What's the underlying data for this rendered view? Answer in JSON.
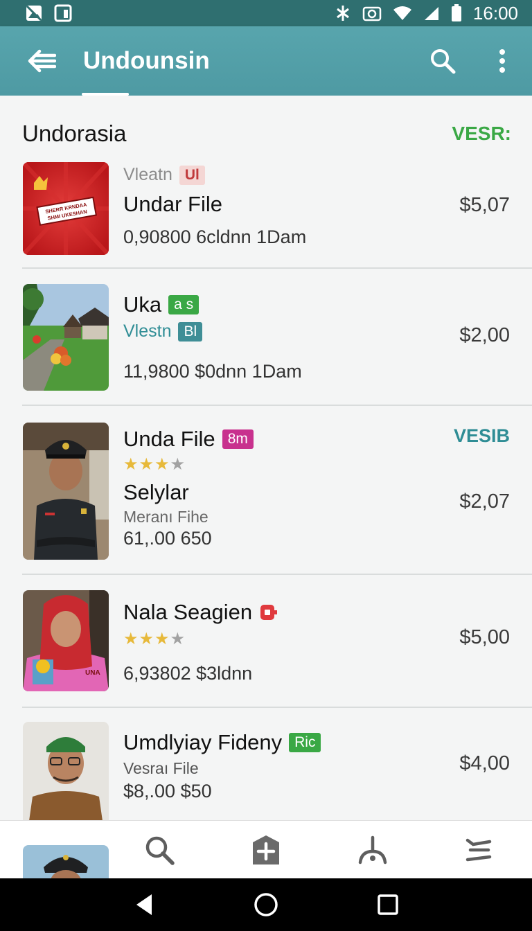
{
  "status_bar": {
    "time": "16:00",
    "icons": [
      "image-icon",
      "sim-icon",
      "bluetooth-icon",
      "camera-icon",
      "wifi-icon",
      "signal-icon",
      "battery-icon"
    ]
  },
  "app_bar": {
    "title": "Undounsin",
    "icons": [
      "back-arrow-icon",
      "search-icon",
      "more-vert-icon"
    ]
  },
  "section": {
    "title": "Undorasia",
    "action": "VESR:"
  },
  "items": [
    {
      "overline": "Vleatn",
      "overline_badge": "Ul",
      "title": "Undar File",
      "meta": "0,90800  6cldnn  1Dam",
      "price": "$5,07"
    },
    {
      "title": "Uka",
      "title_badge": "a s",
      "overline": "Vlestn",
      "overline_badge": "Bl",
      "meta": "11,9800  $0dnn  1Dam",
      "price": "$2,00"
    },
    {
      "title": "Unda File",
      "title_badge": "8m",
      "rating": 3,
      "rating_max": 4,
      "subtitle": "Selylar",
      "sub": "Meranı Fihe",
      "meta": "61,.00  650",
      "tag": "VESIB",
      "price": "$2,07"
    },
    {
      "title": "Nala Seagien",
      "rating": 3,
      "rating_max": 4,
      "meta": "6,93802  $3ldnn",
      "price": "$5,00"
    },
    {
      "title": "Umdlyiay Fideny",
      "title_badge": "Ric",
      "sub": "Vesraı File",
      "meta": "$8,.00  $50",
      "price": "$4,00"
    }
  ],
  "thumb_text": {
    "item1": "SHERR KRNDAA SHMI UKESHAN"
  },
  "bottom_nav": {
    "icons": [
      "profile-avatar",
      "search-icon",
      "add-icon",
      "person-icon",
      "menu-icon"
    ]
  },
  "system_nav": {
    "icons": [
      "back-triangle-icon",
      "home-circle-icon",
      "recents-square-icon"
    ]
  },
  "colors": {
    "app_bar": "#4e9aa3",
    "status_bar": "#2f6f70",
    "accent_green": "#3aa845",
    "accent_teal": "#2f8d95",
    "badge_pink": "#c8318e",
    "badge_green": "#3aa845",
    "badge_teal": "#3f8e96"
  }
}
